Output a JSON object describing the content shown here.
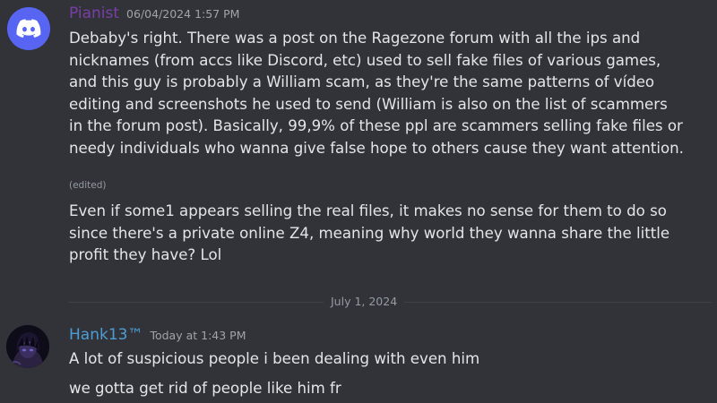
{
  "messages": [
    {
      "username": "Pianist",
      "username_color": "#7a3fa6",
      "timestamp": "06/04/2024 1:57 PM",
      "avatar_icon": "discord-logo-icon",
      "lines": [
        "Debaby's right. There was a post on the Ragezone forum with all the ips and",
        "nicknames (from accs like Discord, etc) used to sell fake files of various games,",
        "and this guy is probably a William scam, as they're the same patterns of vídeo",
        "editing and screenshots he used to send (William is also on the list of scammers",
        "in the forum post). Basically, 99,9% of these ppl are scammers selling fake files or",
        "needy individuals who wanna give false hope to others cause they want attention."
      ],
      "edited_label": "(edited)",
      "followup_lines": [
        "Even if some1 appears selling the real files, it makes no sense for them to do so",
        "since there's a private online Z4, meaning why world they wanna share the little",
        "profit they have? Lol"
      ]
    },
    {
      "username": "Hank13™",
      "username_color": "#4e9dd6",
      "timestamp": "Today at 1:43 PM",
      "avatar_icon": "dark-anime-avatar-icon",
      "lines": [
        "A lot of suspicious people i been dealing with even him",
        "we gotta get rid of people like him fr"
      ]
    }
  ],
  "date_divider": "July 1, 2024"
}
